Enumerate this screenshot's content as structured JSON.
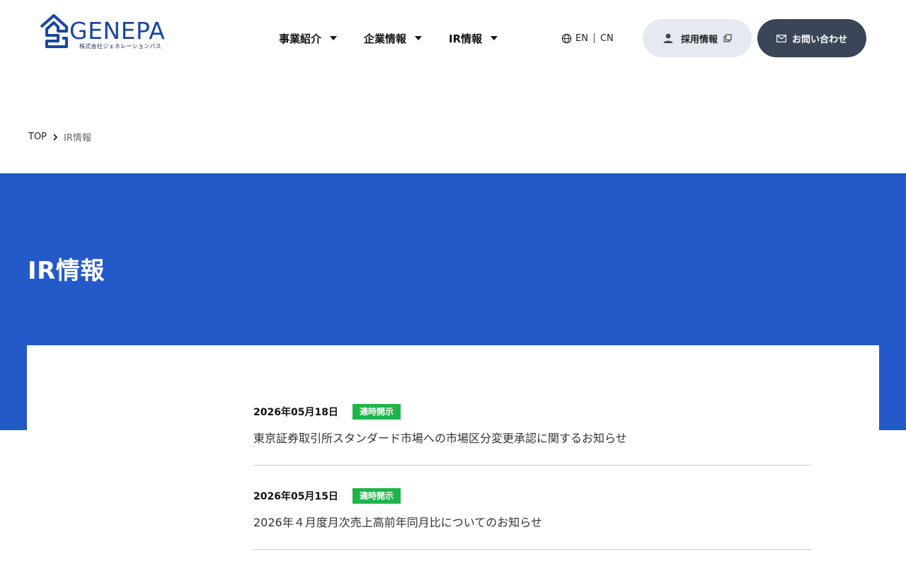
{
  "brand": {
    "name": "GENEPA",
    "subtitle": "株式会社ジェネレーションパス",
    "color": "#1a46a0"
  },
  "nav": {
    "items": [
      {
        "label": "事業紹介"
      },
      {
        "label": "企業情報"
      },
      {
        "label": "IR情報"
      }
    ]
  },
  "lang": {
    "en": "EN",
    "cn": "CN"
  },
  "header_buttons": {
    "recruit": "採用情報",
    "contact": "お問い合わせ"
  },
  "breadcrumb": {
    "top": "TOP",
    "current": "IR情報"
  },
  "hero": {
    "title": "IR情報",
    "color": "#2459c9"
  },
  "news": [
    {
      "date": "2026年05月18日",
      "tag": "適時開示",
      "title": "東京証券取引所スタンダード市場への市場区分変更承認に関するお知らせ"
    },
    {
      "date": "2026年05月15日",
      "tag": "適時開示",
      "title": "2026年４月度月次売上高前年同月比についてのお知らせ"
    }
  ],
  "colors": {
    "tag_green": "#1db54a",
    "contact_button": "#3a4558",
    "recruit_button": "#e6e9f1"
  }
}
